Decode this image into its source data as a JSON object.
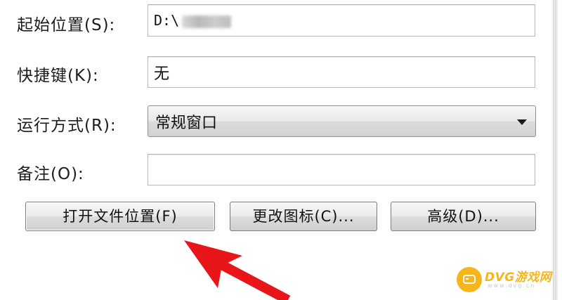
{
  "form": {
    "start_in": {
      "label": "起始位置(S):",
      "value": "D:\\"
    },
    "shortcut_key": {
      "label": "快捷键(K):",
      "value": "无"
    },
    "run": {
      "label": "运行方式(R):",
      "selected": "常规窗口"
    },
    "comment": {
      "label": "备注(O):",
      "value": ""
    }
  },
  "buttons": {
    "open_file_location": "打开文件位置(F)",
    "change_icon": "更改图标(C)...",
    "advanced": "高级(D)..."
  },
  "annotation": {
    "arrow_color": "#e8161b"
  },
  "watermark": {
    "name": "DVG游戏网",
    "url": "www.dvg.cn",
    "color": "#f6b51a"
  }
}
